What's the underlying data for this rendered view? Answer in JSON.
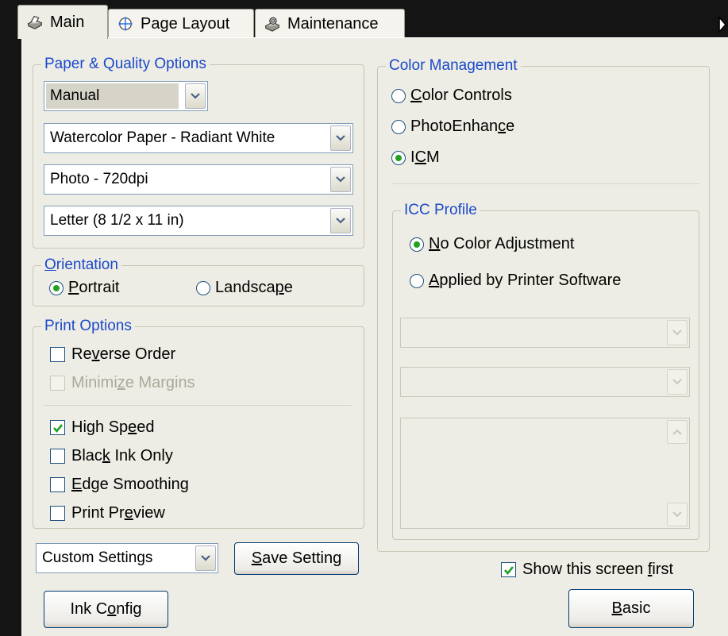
{
  "tabs": [
    {
      "label": "Main",
      "icon": "printer-icon"
    },
    {
      "label": "Page Layout",
      "icon": "page-layout-icon"
    },
    {
      "label": "Maintenance",
      "icon": "maintenance-icon"
    }
  ],
  "paper_quality": {
    "legend": "Paper & Quality Options",
    "mode": "Manual",
    "paper_type": "Watercolor Paper - Radiant White",
    "quality": "Photo - 720dpi",
    "paper_size": "Letter (8 1/2 x 11 in)"
  },
  "orientation": {
    "legend": "Orientation",
    "portrait": "Portrait",
    "landscape": "Landscape",
    "selected": "Portrait"
  },
  "print_options": {
    "legend": "Print Options",
    "reverse_order": {
      "label": "Reverse Order",
      "checked": false
    },
    "minimize_margins": {
      "label": "Minimize Margins",
      "checked": false,
      "disabled": true
    },
    "high_speed": {
      "label": "High Speed",
      "checked": true
    },
    "black_ink_only": {
      "label": "Black Ink Only",
      "checked": false
    },
    "edge_smoothing": {
      "label": "Edge Smoothing",
      "checked": false
    },
    "print_preview": {
      "label": "Print Preview",
      "checked": false
    }
  },
  "custom_settings": {
    "value": "Custom Settings"
  },
  "buttons": {
    "save_setting": "Save Setting",
    "ink_config": "Ink Config",
    "basic": "Basic"
  },
  "color_management": {
    "legend": "Color Management",
    "color_controls": "Color Controls",
    "photo_enhance": "PhotoEnhance",
    "icm": "ICM",
    "selected": "ICM"
  },
  "icc_profile": {
    "legend": "ICC Profile",
    "no_color_adjustment": "No Color Adjustment",
    "applied_by_printer": "Applied by Printer Software",
    "selected": "No Color Adjustment"
  },
  "show_first": {
    "label": "Show this screen first",
    "checked": true
  },
  "colors": {
    "accent_legend": "#1a49cb",
    "panel_bg": "#eeede5",
    "radio_dot": "#21a121",
    "check_mark": "#21a121"
  }
}
